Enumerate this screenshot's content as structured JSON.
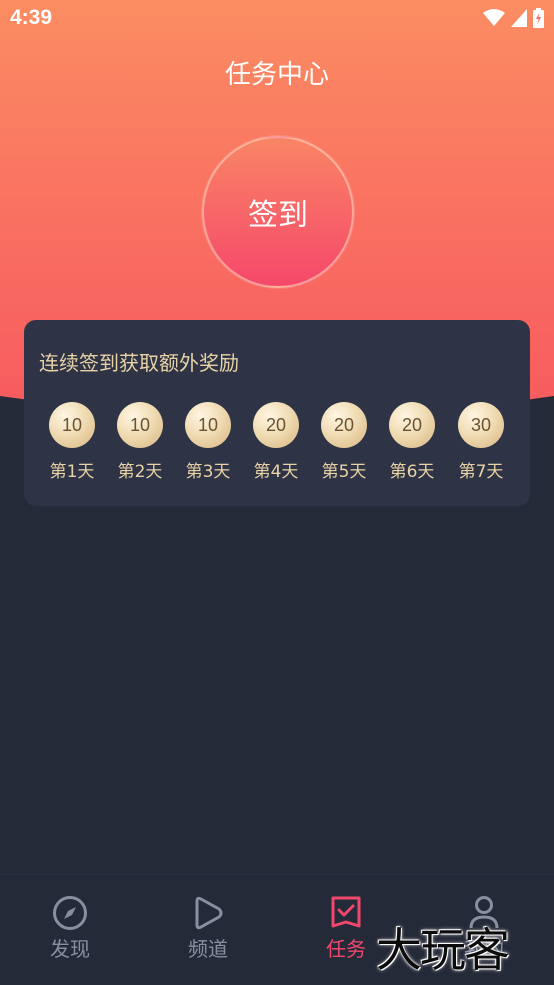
{
  "status": {
    "time": "4:39"
  },
  "header": {
    "title": "任务中心"
  },
  "checkin": {
    "button_label": "签到"
  },
  "reward": {
    "title": "连续签到获取额外奖励",
    "days": [
      {
        "points": "10",
        "label": "第1天"
      },
      {
        "points": "10",
        "label": "第2天"
      },
      {
        "points": "10",
        "label": "第3天"
      },
      {
        "points": "20",
        "label": "第4天"
      },
      {
        "points": "20",
        "label": "第5天"
      },
      {
        "points": "20",
        "label": "第6天"
      },
      {
        "points": "30",
        "label": "第7天"
      }
    ]
  },
  "tabbar": {
    "items": [
      {
        "label": "发现",
        "icon": "compass-icon"
      },
      {
        "label": "频道",
        "icon": "play-icon"
      },
      {
        "label": "任务",
        "icon": "task-check-icon",
        "active": true
      },
      {
        "label": "我的",
        "icon": "user-icon"
      }
    ]
  },
  "watermark": "大玩客",
  "colors": {
    "accent": "#f0486c",
    "gold": "#e9d3a6",
    "background": "#252a38"
  }
}
